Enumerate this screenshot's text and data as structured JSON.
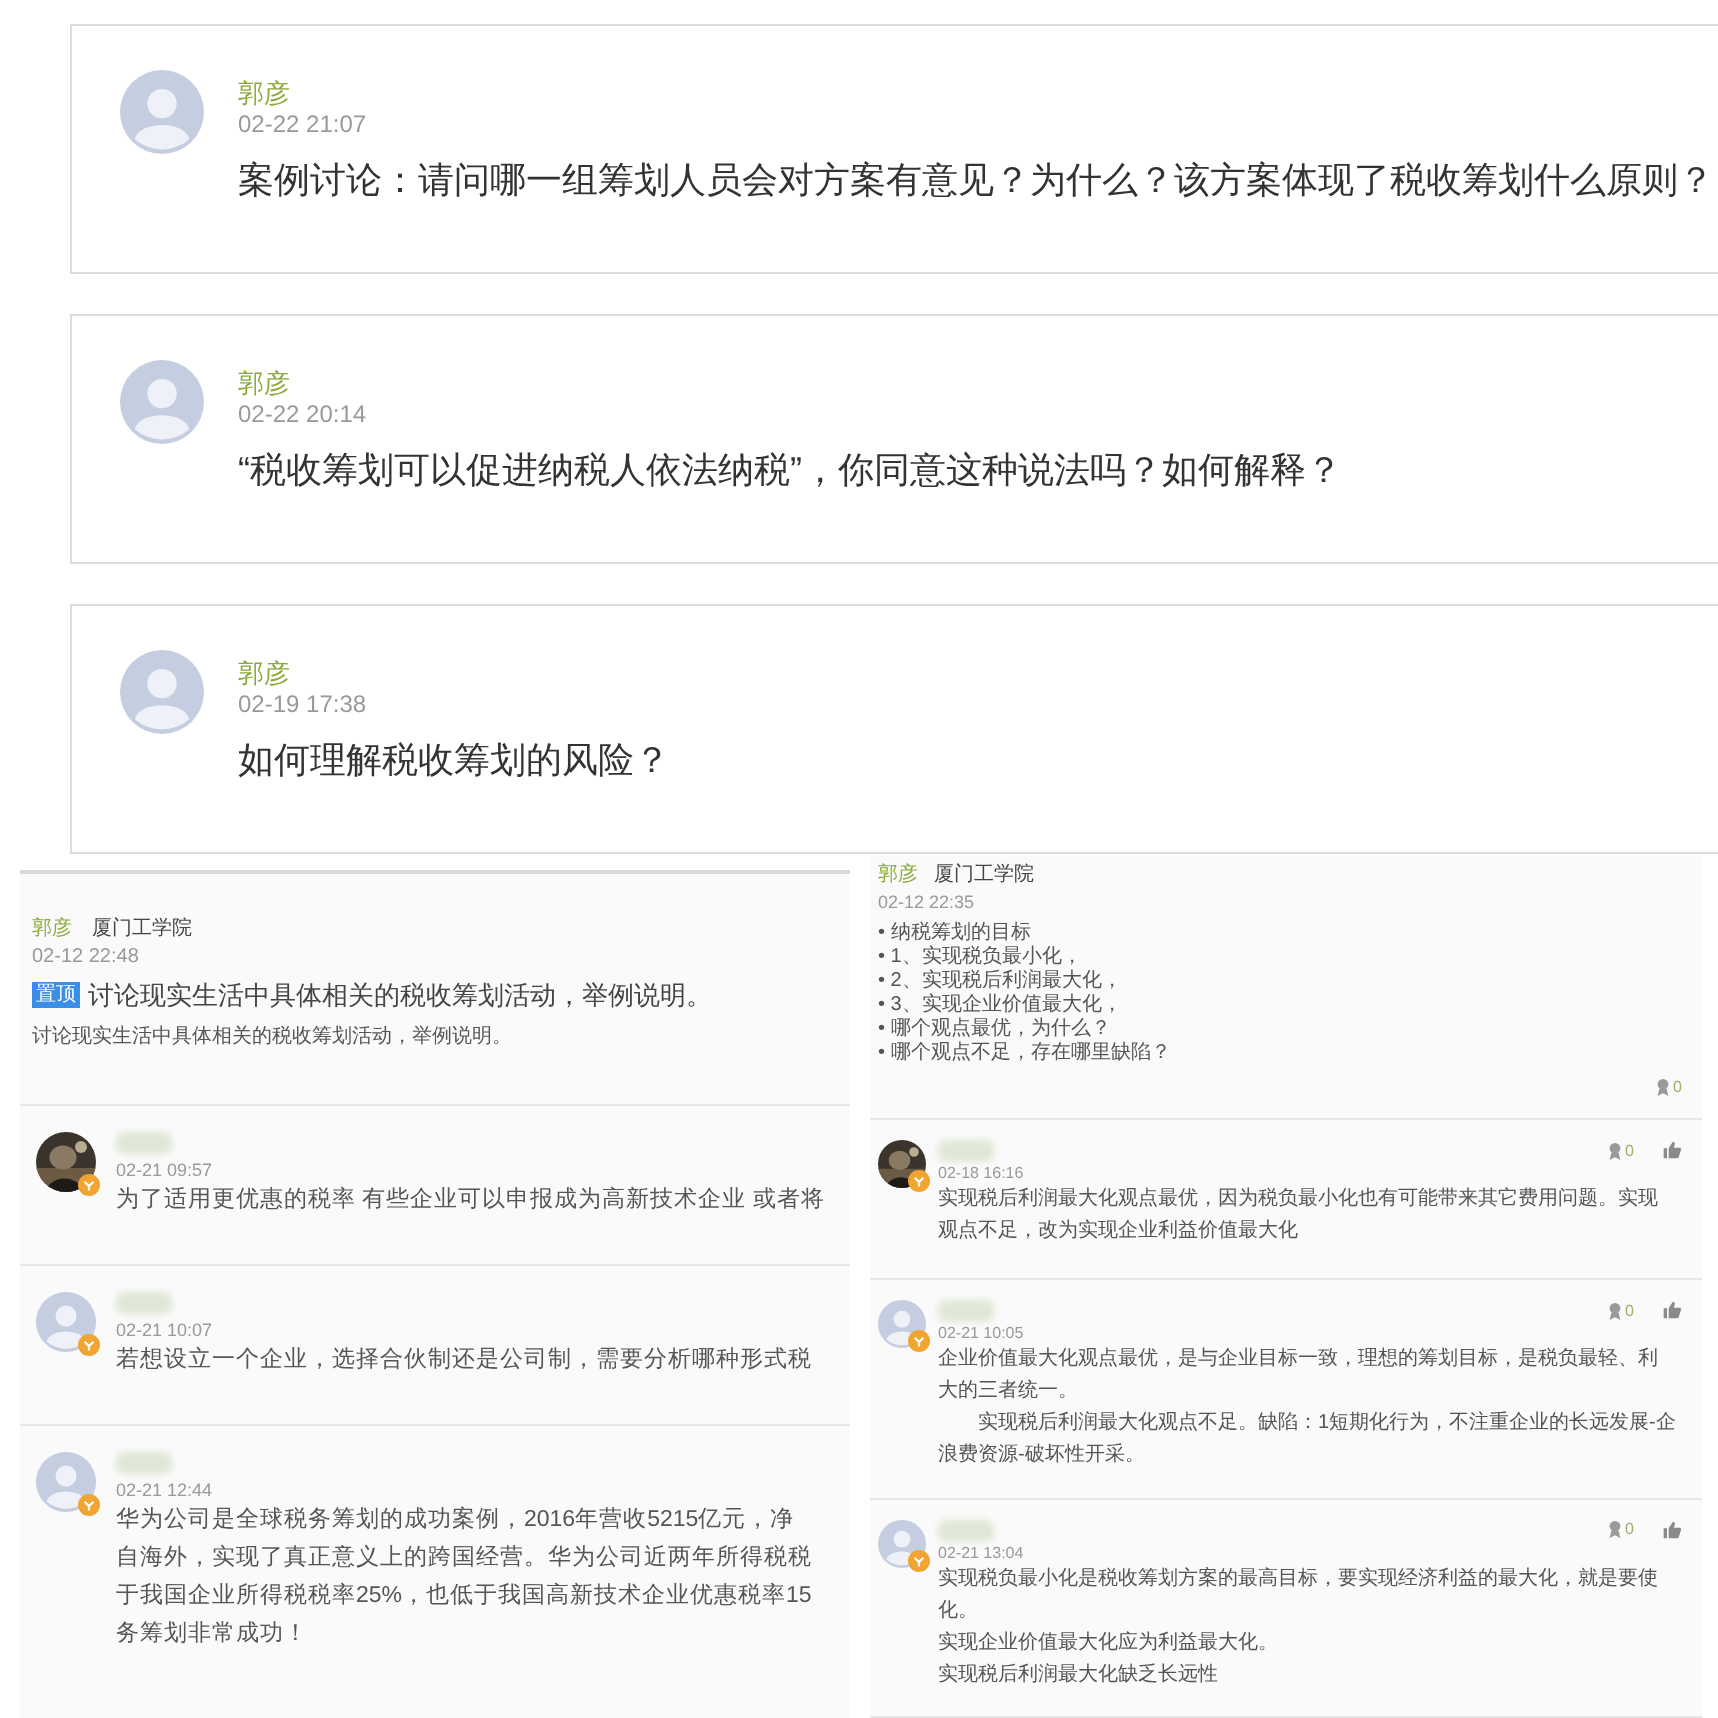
{
  "questions": [
    {
      "author": "郭彦",
      "time": "02-22 21:07",
      "text": "案例讨论：请问哪一组筹划人员会对方案有意见？为什么？该方案体现了税收筹划什么原则？"
    },
    {
      "author": "郭彦",
      "time": "02-22 20:14",
      "text": "“税收筹划可以促进纳税人依法纳税”，你同意这种说法吗？如何解释？"
    },
    {
      "author": "郭彦",
      "time": "02-19 17:38",
      "text": "如何理解税收筹划的风险？"
    }
  ],
  "left_panel": {
    "post": {
      "author": "郭彦",
      "school": "厦门工学院",
      "time": "02-12 22:48",
      "badge": "置顶",
      "title": "讨论现实生活中具体相关的税收筹划活动，举例说明。",
      "body": "讨论现实生活中具体相关的税收筹划活动，举例说明。"
    },
    "comments": [
      {
        "time": "02-21 09:57",
        "lines": [
          "为了适用更优惠的税率 有些企业可以申报成为高新技术企业 或者将"
        ]
      },
      {
        "kind": "default",
        "time": "02-21 10:07",
        "lines": [
          "若想设立一个企业，选择合伙制还是公司制，需要分析哪种形式税"
        ]
      },
      {
        "kind": "default",
        "time": "02-21 12:44",
        "lines": [
          "华为公司是全球税务筹划的成功案例，2016年营收5215亿元，净",
          "自海外，实现了真正意义上的跨国经营。华为公司近两年所得税税",
          "于我国企业所得税税率25%，也低于我国高新技术企业优惠税率15",
          "务筹划非常成功！"
        ]
      }
    ]
  },
  "right_panel": {
    "post": {
      "author": "郭彦",
      "school": "厦门工学院",
      "time": "02-12 22:35",
      "items": [
        "• 纳税筹划的目标",
        "• 1、实现税负最小化，",
        "• 2、实现税后利润最大化，",
        "• 3、实现企业价值最大化，",
        "• 哪个观点最优，为什么？",
        "• 哪个观点不足，存在哪里缺陷？"
      ],
      "award_count": "0"
    },
    "comments": [
      {
        "time": "02-18 16:16",
        "award_count": "0",
        "lines": [
          "实现税后利润最大化观点最优，因为税负最小化也有可能带来其它费用问题。实现",
          "观点不足，改为实现企业利益价值最大化"
        ]
      },
      {
        "kind": "default",
        "time": "02-21 10:05",
        "award_count": "0",
        "lines": [
          "企业价值最大化观点最优，是与企业目标一致，理想的筹划目标，是税负最轻、利",
          "大的三者统一。",
          "　　实现税后利润最大化观点不足。缺陷：1短期化行为，不注重企业的长远发展-企",
          "浪费资源-破坏性开采。"
        ]
      },
      {
        "kind": "default",
        "time": "02-21 13:04",
        "award_count": "0",
        "lines": [
          "实现税负最小化是税收筹划方案的最高目标，要实现经济利益的最大化，就是要使",
          "化。",
          "实现企业价值最大化应为利益最大化。",
          "实现税后利润最大化缺乏长远性"
        ]
      }
    ]
  }
}
